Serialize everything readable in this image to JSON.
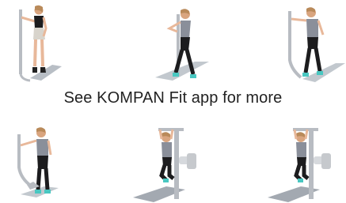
{
  "caption": "See KOMPAN Fit app for more",
  "illustrations": [
    {
      "icon": "woman-standing-stretch-pole-figure"
    },
    {
      "icon": "man-walking-side-stretch-pole-figure"
    },
    {
      "icon": "man-lunge-arm-stretch-figure"
    },
    {
      "icon": "man-step-arm-stretch-figure"
    },
    {
      "icon": "man-pull-up-station-figure"
    },
    {
      "icon": "man-pull-up-station-figure-2"
    }
  ],
  "colors": {
    "skin": "#e8b89a",
    "shirt_gray": "#8a8f9a",
    "shorts_dark": "#1c1c1e",
    "shoe_accent": "#49c7c1",
    "pole": "#b8bcc2",
    "shadow": "#9aa3ad"
  }
}
